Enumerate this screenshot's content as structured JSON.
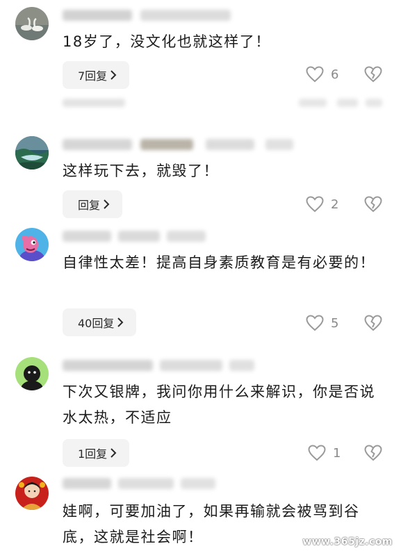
{
  "comments": [
    {
      "text": "18岁了，没文化也就这样了！",
      "reply_label": "7回复",
      "like_count": "6",
      "avatar_icon": "swan-avatar-icon"
    },
    {
      "text": "这样玩下去，就毁了！",
      "reply_label": "回复",
      "like_count": "2",
      "avatar_icon": "landscape-avatar-icon"
    },
    {
      "text": "自律性太差！提高自身素质教育是有必要的！",
      "reply_label": "40回复",
      "like_count": "5",
      "avatar_icon": "cartoon-avatar-icon"
    },
    {
      "text": "下次又银牌，我问你用什么来解识，你是否说水太热，不适应",
      "reply_label": "1回复",
      "like_count": "1",
      "avatar_icon": "black-character-avatar-icon"
    },
    {
      "text": "娃啊，可要加油了，如果再输就会被骂到谷底，这就是社会啊！",
      "reply_label": "",
      "like_count": "",
      "avatar_icon": "festive-avatar-icon"
    }
  ],
  "watermark": "www.365jz.com",
  "colors": {
    "icon_gray": "#9a9a9a",
    "reply_bg": "#f3f3f3",
    "blur_gray": "#d6d6d6"
  }
}
